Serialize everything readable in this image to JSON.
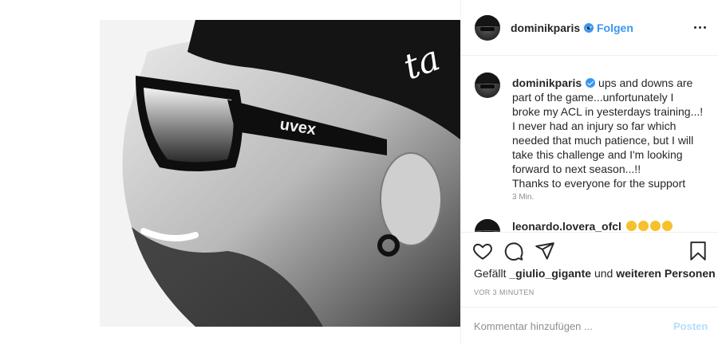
{
  "header": {
    "username": "dominikparis",
    "separator": "•",
    "follow_label": "Folgen"
  },
  "caption": {
    "username": "dominikparis",
    "lines": [
      "ups and downs are",
      "part of the game...unfortunately I",
      "broke my ACL in yesterdays training...!",
      "I never had an injury so far which",
      "needed that much patience, but I will",
      "take this challenge and I'm looking",
      "forward to next season...!!",
      "Thanks to everyone for the support"
    ],
    "time": "3 Min."
  },
  "comment2": {
    "username": "leonardo.lovera_ofcl"
  },
  "likes": {
    "prefix": "Gefällt",
    "user": "_giulio_gigante",
    "middle": "und",
    "others": "weiteren Personen"
  },
  "post_time": "VOR 3 MINUTEN",
  "add_comment": {
    "placeholder": "Kommentar hinzufügen ...",
    "post_label": "Posten"
  },
  "photo": {
    "glasses_brand": "uvex",
    "cap_text": "ta"
  },
  "colors": {
    "accent": "#3897f0",
    "text": "#262626",
    "secondary": "#8e8e8e",
    "border": "#efefef",
    "post_disabled": "#b2dffc"
  },
  "icons": [
    "heart-icon",
    "comment-icon",
    "share-icon",
    "bookmark-icon",
    "more-icon",
    "verified-icon"
  ]
}
